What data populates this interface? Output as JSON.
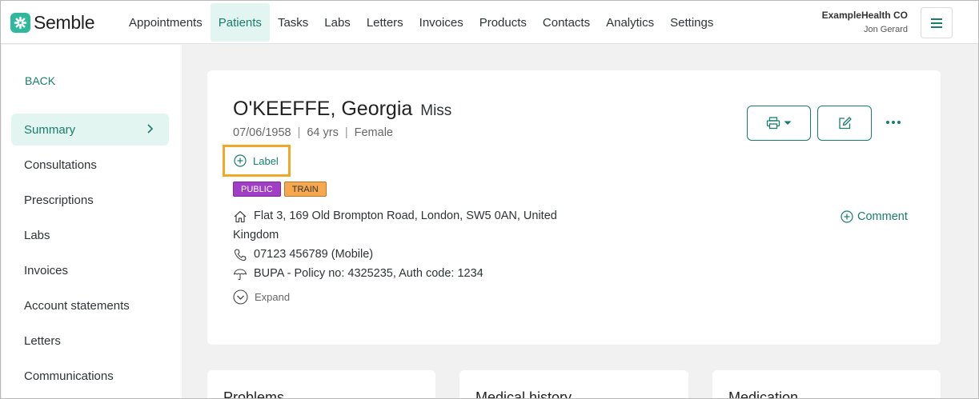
{
  "brand": {
    "name": "Semble",
    "accent": "#177e6c",
    "logo_color": "#2fb89b"
  },
  "nav": {
    "items": [
      {
        "label": "Appointments",
        "active": false
      },
      {
        "label": "Patients",
        "active": true
      },
      {
        "label": "Tasks",
        "active": false
      },
      {
        "label": "Labs",
        "active": false
      },
      {
        "label": "Letters",
        "active": false
      },
      {
        "label": "Invoices",
        "active": false
      },
      {
        "label": "Products",
        "active": false
      },
      {
        "label": "Contacts",
        "active": false
      },
      {
        "label": "Analytics",
        "active": false
      },
      {
        "label": "Settings",
        "active": false
      }
    ],
    "org_name": "ExampleHealth CO",
    "user_name": "Jon Gerard",
    "menu_icon": "hamburger-icon"
  },
  "sidebar": {
    "back_label": "BACK",
    "items": [
      {
        "label": "Summary",
        "active": true
      },
      {
        "label": "Consultations",
        "active": false
      },
      {
        "label": "Prescriptions",
        "active": false
      },
      {
        "label": "Labs",
        "active": false
      },
      {
        "label": "Invoices",
        "active": false
      },
      {
        "label": "Account statements",
        "active": false
      },
      {
        "label": "Letters",
        "active": false
      },
      {
        "label": "Communications",
        "active": false
      }
    ]
  },
  "patient": {
    "name": "O'KEEFFE, Georgia",
    "title": "Miss",
    "dob": "07/06/1958",
    "age": "64 yrs",
    "gender": "Female",
    "label_action": "Label",
    "tags": [
      {
        "label": "PUBLIC",
        "color": "#a03ec6"
      },
      {
        "label": "TRAIN",
        "color": "#f5a84e"
      }
    ],
    "address_line1": "Flat 3, 169 Old Brompton Road, London, SW5 0AN, United",
    "address_line2": "Kingdom",
    "phone": "07123 456789 (Mobile)",
    "insurance": "BUPA - Policy no: 4325235, Auth code: 1234",
    "expand_label": "Expand",
    "comment_label": "Comment"
  },
  "bottom_cards": [
    {
      "title": "Problems"
    },
    {
      "title": "Medical history"
    },
    {
      "title": "Medication"
    }
  ]
}
